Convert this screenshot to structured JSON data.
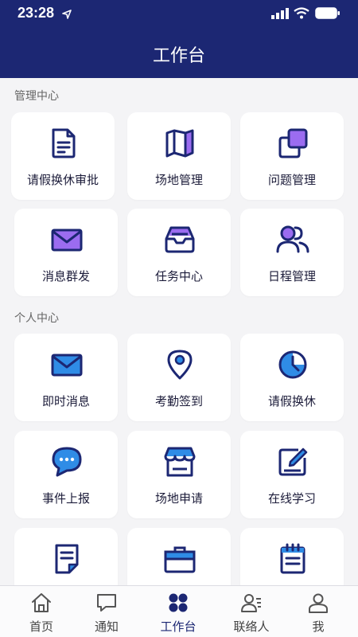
{
  "status_bar": {
    "time": "23:28"
  },
  "header": {
    "title": "工作台"
  },
  "sections": [
    {
      "title": "管理中心",
      "items": [
        {
          "label": "请假换休审批",
          "icon": "document-icon"
        },
        {
          "label": "场地管理",
          "icon": "map-icon"
        },
        {
          "label": "问题管理",
          "icon": "copy-icon"
        },
        {
          "label": "消息群发",
          "icon": "mail-icon"
        },
        {
          "label": "任务中心",
          "icon": "inbox-icon"
        },
        {
          "label": "日程管理",
          "icon": "users-icon"
        }
      ]
    },
    {
      "title": "个人中心",
      "items": [
        {
          "label": "即时消息",
          "icon": "mail-icon"
        },
        {
          "label": "考勤签到",
          "icon": "location-pin-icon"
        },
        {
          "label": "请假换休",
          "icon": "clock-icon"
        },
        {
          "label": "事件上报",
          "icon": "chat-bubble-icon"
        },
        {
          "label": "场地申请",
          "icon": "store-icon"
        },
        {
          "label": "在线学习",
          "icon": "edit-icon"
        },
        {
          "label": "",
          "icon": "note-icon"
        },
        {
          "label": "",
          "icon": "briefcase-icon"
        },
        {
          "label": "",
          "icon": "notepad-icon"
        }
      ]
    }
  ],
  "tabbar": {
    "items": [
      {
        "label": "首页",
        "icon": "home-icon"
      },
      {
        "label": "通知",
        "icon": "message-icon"
      },
      {
        "label": "工作台",
        "icon": "grid-icon",
        "active": true
      },
      {
        "label": "联络人",
        "icon": "contacts-icon"
      },
      {
        "label": "我",
        "icon": "profile-icon"
      }
    ]
  },
  "colors": {
    "header": "#1c2773",
    "accent": "#9b6cf0",
    "icon_navy": "#1c2773",
    "icon_blue": "#2f8ce6"
  }
}
